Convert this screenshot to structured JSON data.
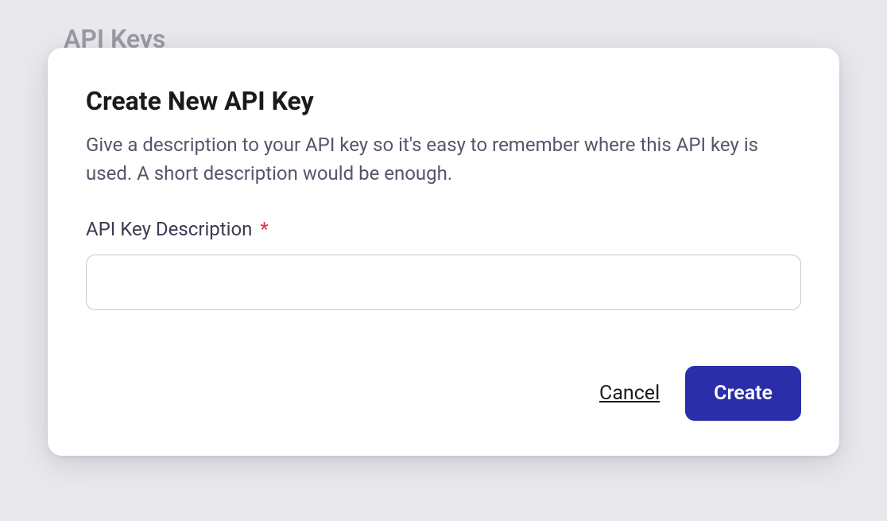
{
  "page": {
    "title": "API Keys"
  },
  "modal": {
    "title": "Create New API Key",
    "description": "Give a description to your API key so it's easy to remember where this API key is used. A short description would be enough.",
    "field": {
      "label": "API Key Description",
      "required_mark": "*",
      "value": ""
    },
    "actions": {
      "cancel_label": "Cancel",
      "create_label": "Create"
    }
  },
  "colors": {
    "primary": "#2a2ea8",
    "text": "#1a1a1a",
    "muted": "#55566b",
    "danger": "#d9304c",
    "bg": "#e8e8ed"
  }
}
